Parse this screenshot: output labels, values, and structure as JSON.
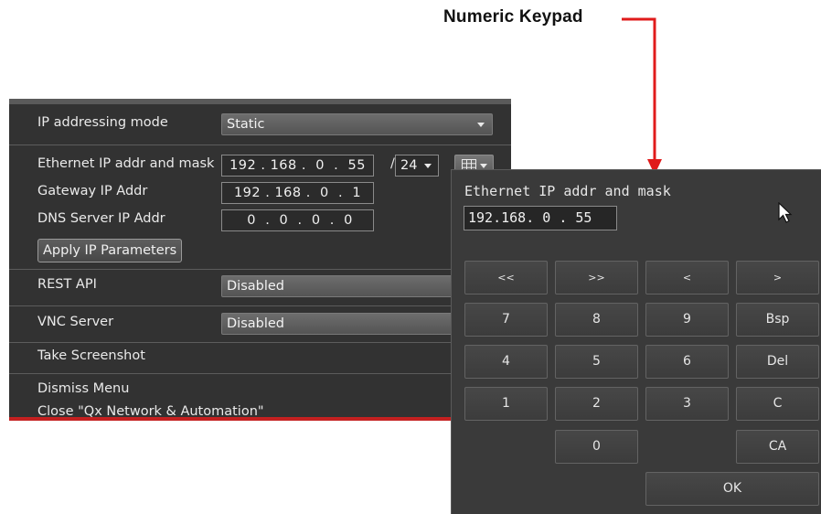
{
  "annotation": {
    "label": "Numeric Keypad",
    "arrow_color": "#e01b1b"
  },
  "menu": {
    "ip_mode": {
      "label": "IP addressing mode",
      "value": "Static"
    },
    "ethernet": {
      "label": "Ethernet IP addr and mask",
      "value": "192 . 168 .  0  .  55",
      "slash": "/",
      "mask": "24",
      "keypad_icon": "keypad-grid-icon"
    },
    "gateway": {
      "label": "Gateway IP Addr",
      "value": "192 . 168 .  0  .  1"
    },
    "dns": {
      "label": "DNS Server IP Addr",
      "value": " 0  .  0  .  0  .  0"
    },
    "apply_label": "Apply IP Parameters",
    "rest_api": {
      "label": "REST API",
      "value": "Disabled"
    },
    "vnc": {
      "label": "VNC Server",
      "value": "Disabled"
    },
    "screenshot_label": "Take Screenshot",
    "dismiss_label": "Dismiss Menu",
    "close_label": "Close \"Qx Network & Automation\""
  },
  "keypad": {
    "title": "Ethernet IP addr and mask",
    "entry_value": "192.168. 0 . 55",
    "keys": {
      "first": "<<",
      "last": ">>",
      "left": "<",
      "right": ">",
      "k7": "7",
      "k8": "8",
      "k9": "9",
      "bsp": "Bsp",
      "k4": "4",
      "k5": "5",
      "k6": "6",
      "del": "Del",
      "k1": "1",
      "k2": "2",
      "k3": "3",
      "clear": "C",
      "k0": "0",
      "clear_all": "CA",
      "ok": "OK"
    }
  },
  "colors": {
    "menu_bg": "#323232",
    "keypad_bg": "#3a3a3a",
    "accent_red": "#c42020"
  }
}
